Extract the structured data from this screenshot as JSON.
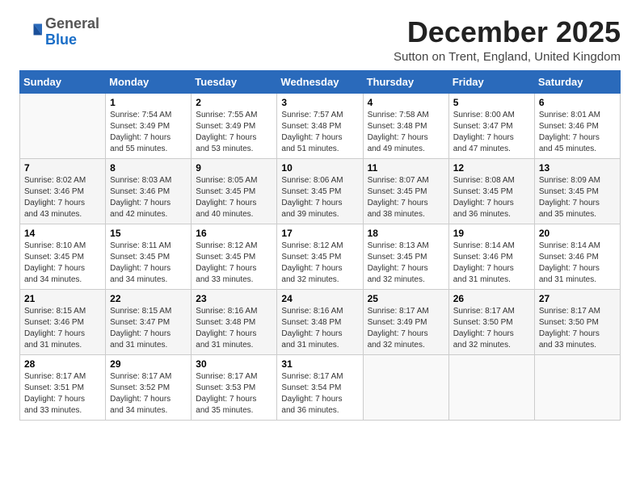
{
  "logo": {
    "general": "General",
    "blue": "Blue"
  },
  "header": {
    "month": "December 2025",
    "location": "Sutton on Trent, England, United Kingdom"
  },
  "days_of_week": [
    "Sunday",
    "Monday",
    "Tuesday",
    "Wednesday",
    "Thursday",
    "Friday",
    "Saturday"
  ],
  "weeks": [
    [
      {
        "day": "",
        "info": ""
      },
      {
        "day": "1",
        "info": "Sunrise: 7:54 AM\nSunset: 3:49 PM\nDaylight: 7 hours\nand 55 minutes."
      },
      {
        "day": "2",
        "info": "Sunrise: 7:55 AM\nSunset: 3:49 PM\nDaylight: 7 hours\nand 53 minutes."
      },
      {
        "day": "3",
        "info": "Sunrise: 7:57 AM\nSunset: 3:48 PM\nDaylight: 7 hours\nand 51 minutes."
      },
      {
        "day": "4",
        "info": "Sunrise: 7:58 AM\nSunset: 3:48 PM\nDaylight: 7 hours\nand 49 minutes."
      },
      {
        "day": "5",
        "info": "Sunrise: 8:00 AM\nSunset: 3:47 PM\nDaylight: 7 hours\nand 47 minutes."
      },
      {
        "day": "6",
        "info": "Sunrise: 8:01 AM\nSunset: 3:46 PM\nDaylight: 7 hours\nand 45 minutes."
      }
    ],
    [
      {
        "day": "7",
        "info": "Sunrise: 8:02 AM\nSunset: 3:46 PM\nDaylight: 7 hours\nand 43 minutes."
      },
      {
        "day": "8",
        "info": "Sunrise: 8:03 AM\nSunset: 3:46 PM\nDaylight: 7 hours\nand 42 minutes."
      },
      {
        "day": "9",
        "info": "Sunrise: 8:05 AM\nSunset: 3:45 PM\nDaylight: 7 hours\nand 40 minutes."
      },
      {
        "day": "10",
        "info": "Sunrise: 8:06 AM\nSunset: 3:45 PM\nDaylight: 7 hours\nand 39 minutes."
      },
      {
        "day": "11",
        "info": "Sunrise: 8:07 AM\nSunset: 3:45 PM\nDaylight: 7 hours\nand 38 minutes."
      },
      {
        "day": "12",
        "info": "Sunrise: 8:08 AM\nSunset: 3:45 PM\nDaylight: 7 hours\nand 36 minutes."
      },
      {
        "day": "13",
        "info": "Sunrise: 8:09 AM\nSunset: 3:45 PM\nDaylight: 7 hours\nand 35 minutes."
      }
    ],
    [
      {
        "day": "14",
        "info": "Sunrise: 8:10 AM\nSunset: 3:45 PM\nDaylight: 7 hours\nand 34 minutes."
      },
      {
        "day": "15",
        "info": "Sunrise: 8:11 AM\nSunset: 3:45 PM\nDaylight: 7 hours\nand 34 minutes."
      },
      {
        "day": "16",
        "info": "Sunrise: 8:12 AM\nSunset: 3:45 PM\nDaylight: 7 hours\nand 33 minutes."
      },
      {
        "day": "17",
        "info": "Sunrise: 8:12 AM\nSunset: 3:45 PM\nDaylight: 7 hours\nand 32 minutes."
      },
      {
        "day": "18",
        "info": "Sunrise: 8:13 AM\nSunset: 3:45 PM\nDaylight: 7 hours\nand 32 minutes."
      },
      {
        "day": "19",
        "info": "Sunrise: 8:14 AM\nSunset: 3:46 PM\nDaylight: 7 hours\nand 31 minutes."
      },
      {
        "day": "20",
        "info": "Sunrise: 8:14 AM\nSunset: 3:46 PM\nDaylight: 7 hours\nand 31 minutes."
      }
    ],
    [
      {
        "day": "21",
        "info": "Sunrise: 8:15 AM\nSunset: 3:46 PM\nDaylight: 7 hours\nand 31 minutes."
      },
      {
        "day": "22",
        "info": "Sunrise: 8:15 AM\nSunset: 3:47 PM\nDaylight: 7 hours\nand 31 minutes."
      },
      {
        "day": "23",
        "info": "Sunrise: 8:16 AM\nSunset: 3:48 PM\nDaylight: 7 hours\nand 31 minutes."
      },
      {
        "day": "24",
        "info": "Sunrise: 8:16 AM\nSunset: 3:48 PM\nDaylight: 7 hours\nand 31 minutes."
      },
      {
        "day": "25",
        "info": "Sunrise: 8:17 AM\nSunset: 3:49 PM\nDaylight: 7 hours\nand 32 minutes."
      },
      {
        "day": "26",
        "info": "Sunrise: 8:17 AM\nSunset: 3:50 PM\nDaylight: 7 hours\nand 32 minutes."
      },
      {
        "day": "27",
        "info": "Sunrise: 8:17 AM\nSunset: 3:50 PM\nDaylight: 7 hours\nand 33 minutes."
      }
    ],
    [
      {
        "day": "28",
        "info": "Sunrise: 8:17 AM\nSunset: 3:51 PM\nDaylight: 7 hours\nand 33 minutes."
      },
      {
        "day": "29",
        "info": "Sunrise: 8:17 AM\nSunset: 3:52 PM\nDaylight: 7 hours\nand 34 minutes."
      },
      {
        "day": "30",
        "info": "Sunrise: 8:17 AM\nSunset: 3:53 PM\nDaylight: 7 hours\nand 35 minutes."
      },
      {
        "day": "31",
        "info": "Sunrise: 8:17 AM\nSunset: 3:54 PM\nDaylight: 7 hours\nand 36 minutes."
      },
      {
        "day": "",
        "info": ""
      },
      {
        "day": "",
        "info": ""
      },
      {
        "day": "",
        "info": ""
      }
    ]
  ]
}
